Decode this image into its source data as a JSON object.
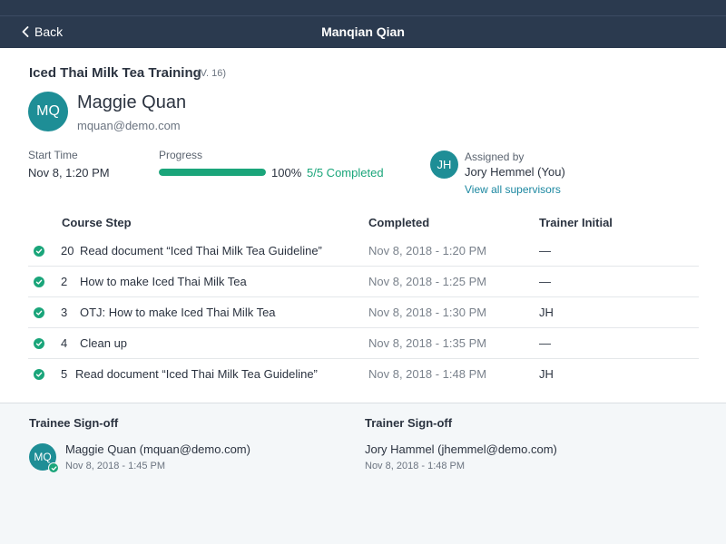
{
  "header": {
    "back_label": "Back",
    "title": "Manqian Qian"
  },
  "course": {
    "title": "Iced Thai Milk Tea Training",
    "version": "(V. 16)"
  },
  "trainee": {
    "initials": "MQ",
    "name": "Maggie Quan",
    "email": "mquan@demo.com"
  },
  "meta": {
    "start_label": "Start Time",
    "start_value": "Nov 8, 1:20 PM",
    "progress_label": "Progress",
    "progress_fraction": 1.0,
    "progress_percent": "100%",
    "progress_completed": "5/5 Completed"
  },
  "supervisor": {
    "initials": "JH",
    "assigned_label": "Assigned by",
    "name": "Jory Hemmel (You)",
    "view_all_label": "View all supervisors"
  },
  "table": {
    "columns": [
      "Course Step",
      "Completed",
      "Trainer Initial"
    ],
    "rows": [
      {
        "num": "20",
        "name": "Read document “Iced Thai Milk Tea Guideline”",
        "completed": "Nov 8, 2018 - 1:20 PM",
        "initial": "—",
        "status": "complete"
      },
      {
        "num": "2",
        "name": "How to make Iced Thai Milk Tea",
        "completed": "Nov 8, 2018 - 1:25 PM",
        "initial": "—",
        "status": "complete"
      },
      {
        "num": "3",
        "name": "OTJ: How to make Iced Thai Milk Tea",
        "completed": "Nov 8, 2018 - 1:30 PM",
        "initial": "JH",
        "status": "complete"
      },
      {
        "num": "4",
        "name": "Clean up",
        "completed": "Nov 8, 2018 - 1:35 PM",
        "initial": "—",
        "status": "complete"
      },
      {
        "num": "5",
        "name": "Read document “Iced Thai Milk Tea Guideline”",
        "completed": "Nov 8, 2018 - 1:48 PM",
        "initial": "JH",
        "status": "complete"
      }
    ]
  },
  "signoff": {
    "trainee_heading": "Trainee Sign-off",
    "trainee_initials": "MQ",
    "trainee_name": "Maggie Quan (mquan@demo.com)",
    "trainee_time": "Nov 8, 2018 - 1:45 PM",
    "trainer_heading": "Trainer Sign-off",
    "trainer_name": "Jory Hammel (jhemmel@demo.com)",
    "trainer_time": "Nov 8, 2018 - 1:48 PM"
  },
  "colors": {
    "header_bg": "#2b3a4f",
    "accent_green": "#1aa57a",
    "avatar_teal": "#1e8e96",
    "link_blue": "#1b87a0",
    "signoff_bg": "#f4f7f9"
  },
  "icons": {
    "back": "chevron-left-icon",
    "step_status": "check-circle-icon"
  }
}
